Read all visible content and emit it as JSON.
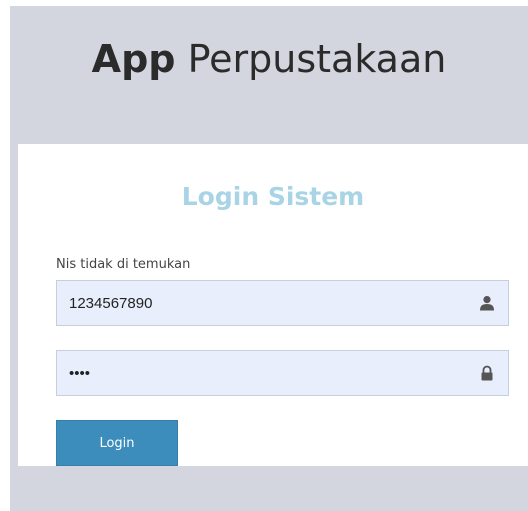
{
  "brand": {
    "bold": "App",
    "light": "Perpustakaan"
  },
  "login_box": {
    "title": "Login Sistem",
    "error_message": "Nis tidak di temukan",
    "nis_field": {
      "value": "1234567890",
      "icon": "user-icon"
    },
    "password_field": {
      "value": "1234",
      "icon": "lock-icon"
    },
    "login_button": "Login"
  },
  "colors": {
    "page_bg": "#d3d6de",
    "title": "#a9d4e6",
    "input_bg": "#e8eefb",
    "button": "#3c8dbc"
  }
}
